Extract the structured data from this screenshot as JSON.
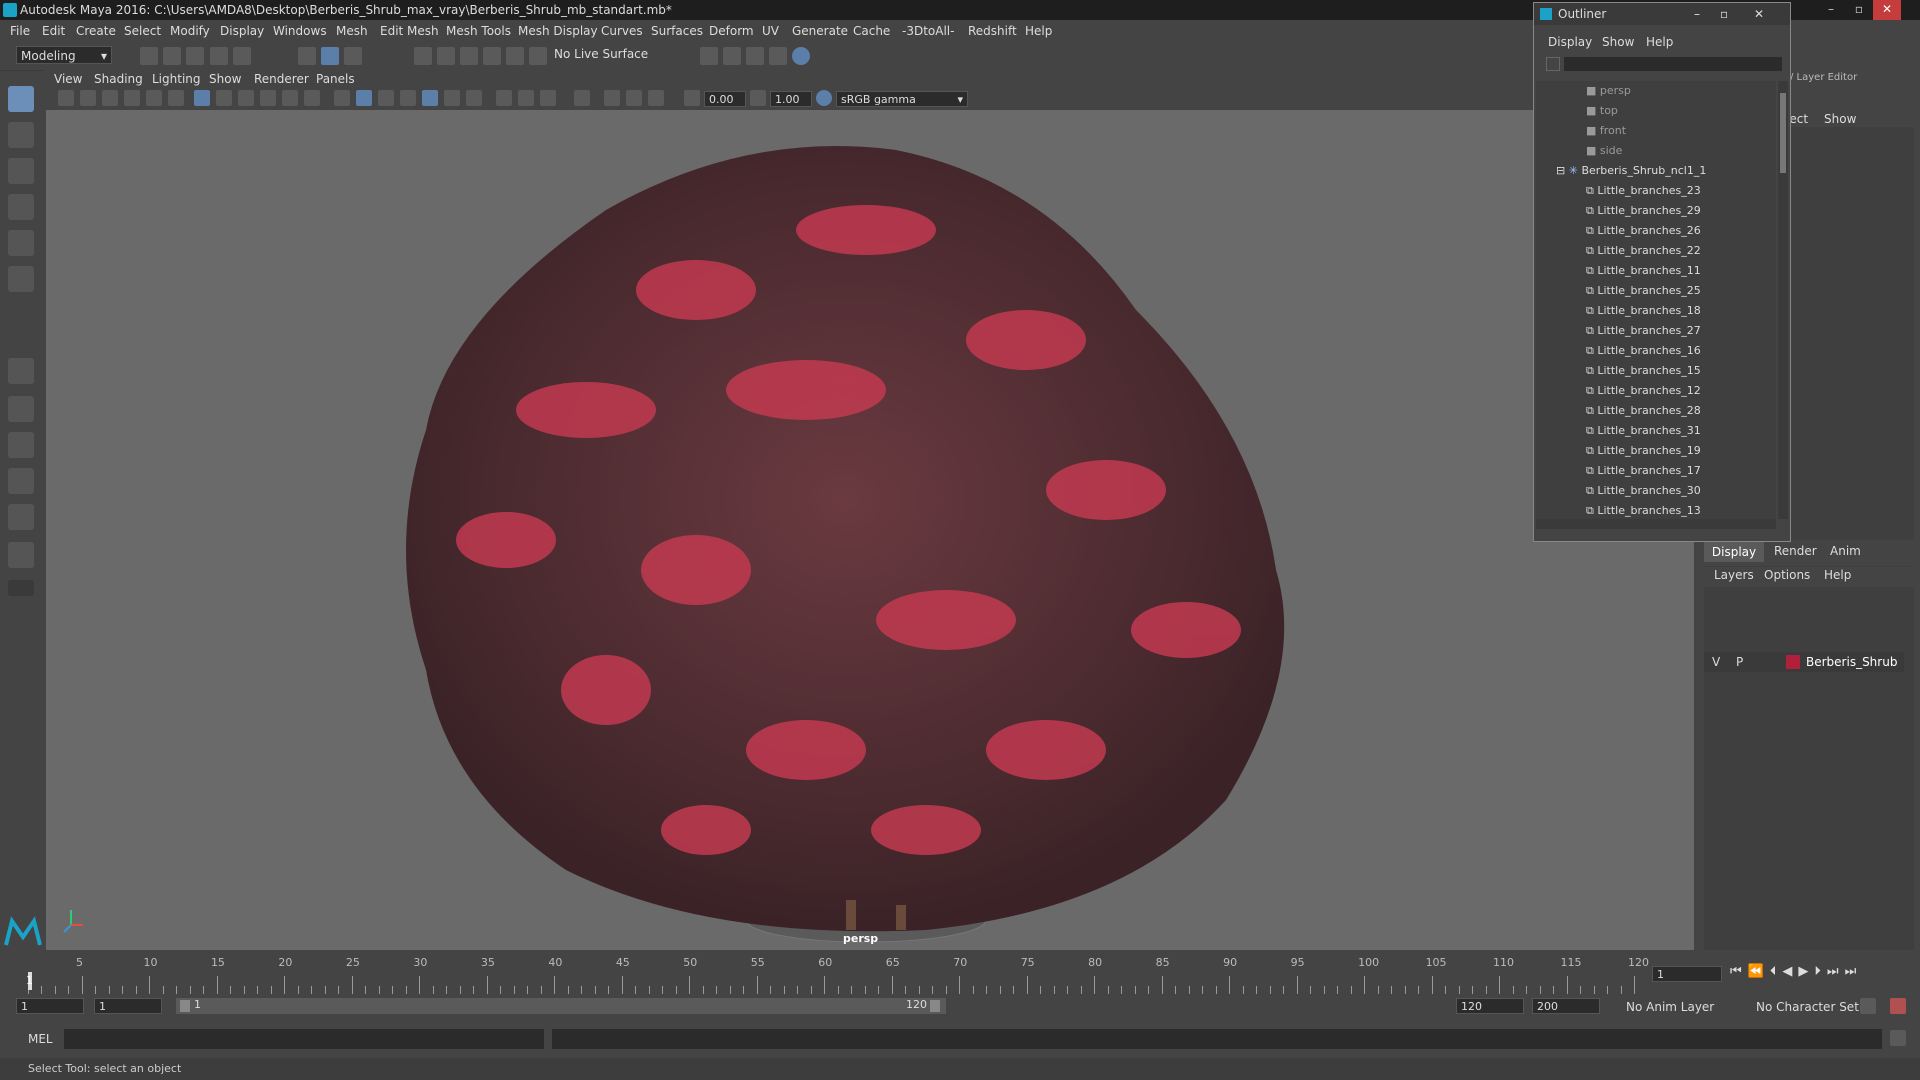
{
  "window": {
    "title": "Autodesk Maya 2016: C:\\Users\\AMDA8\\Desktop\\Berberis_Shrub_max_vray\\Berberis_Shrub_mb_standart.mb*"
  },
  "menu": [
    "File",
    "Edit",
    "Create",
    "Select",
    "Modify",
    "Display",
    "Windows",
    "Mesh",
    "Edit Mesh",
    "Mesh Tools",
    "Mesh Display",
    "Curves",
    "Surfaces",
    "Deform",
    "UV",
    "Generate",
    "Cache",
    "-3DtoAll-",
    "Redshift",
    "Help"
  ],
  "shelf": {
    "mode": "Modeling",
    "live_surface": "No Live Surface"
  },
  "panel_menu": [
    "View",
    "Shading",
    "Lighting",
    "Show",
    "Renderer",
    "Panels"
  ],
  "panel_toolbar": {
    "exposure": "0.00",
    "gamma": "1.00",
    "color_space": "sRGB gamma"
  },
  "viewport": {
    "camera_label": "persp"
  },
  "outliner": {
    "title": "Outliner",
    "menu": [
      "Display",
      "Show",
      "Help"
    ],
    "cameras": [
      "persp",
      "top",
      "front",
      "side"
    ],
    "group": "Berberis_Shrub_ncl1_1",
    "children": [
      "Little_branches_23",
      "Little_branches_29",
      "Little_branches_26",
      "Little_branches_22",
      "Little_branches_11",
      "Little_branches_25",
      "Little_branches_18",
      "Little_branches_27",
      "Little_branches_16",
      "Little_branches_15",
      "Little_branches_12",
      "Little_branches_28",
      "Little_branches_31",
      "Little_branches_19",
      "Little_branches_17",
      "Little_branches_30",
      "Little_branches_13"
    ]
  },
  "right_panel": {
    "layer_editor_label": "/ Layer Editor",
    "top_menu": [
      "Object",
      "Show"
    ],
    "tabs": [
      "Display",
      "Render",
      "Anim"
    ],
    "layer_menu": [
      "Layers",
      "Options",
      "Help"
    ],
    "layer": {
      "visible": "V",
      "playback": "P",
      "name": "Berberis_Shrub",
      "color": "#b0203a"
    }
  },
  "timeline": {
    "ticks": [
      5,
      10,
      15,
      20,
      25,
      30,
      35,
      40,
      45,
      50,
      55,
      60,
      65,
      70,
      75,
      80,
      85,
      90,
      95,
      100,
      105,
      110,
      115,
      120
    ],
    "current_frame_marker": "1",
    "current_frame_field": "1"
  },
  "range": {
    "start": "1",
    "range_start": "1",
    "slider_start": "1",
    "slider_end": "120",
    "range_end": "120",
    "end": "200",
    "anim_layer": "No Anim Layer",
    "char_set": "No Character Set"
  },
  "command": {
    "label": "MEL"
  },
  "status": {
    "message": "Select Tool: select an object"
  }
}
